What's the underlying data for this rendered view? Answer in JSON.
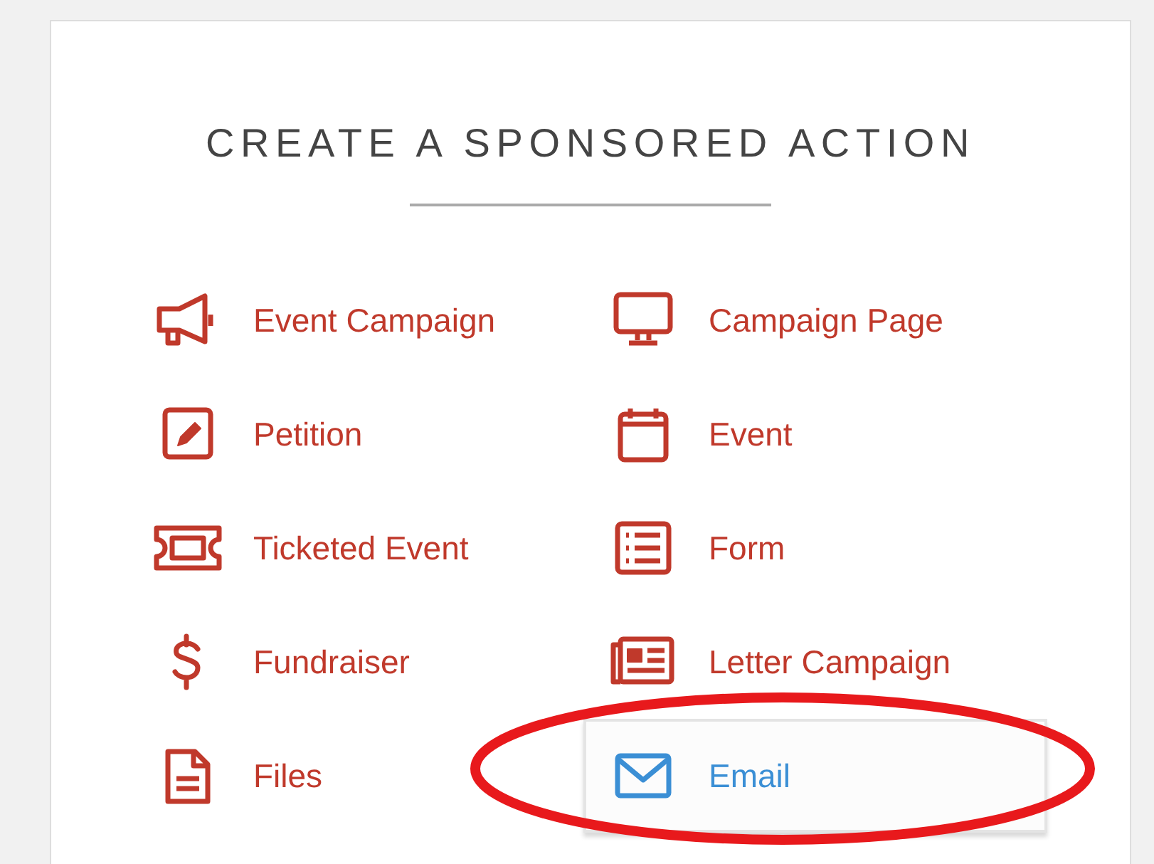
{
  "title": "CREATE A SPONSORED ACTION",
  "actions": [
    {
      "label": "Event Campaign",
      "kind": "megaphone",
      "selected": false,
      "circled": false
    },
    {
      "label": "Campaign Page",
      "kind": "monitor",
      "selected": false,
      "circled": false
    },
    {
      "label": "Petition",
      "kind": "edit",
      "selected": false,
      "circled": false
    },
    {
      "label": "Event",
      "kind": "calendar",
      "selected": false,
      "circled": false
    },
    {
      "label": "Ticketed Event",
      "kind": "ticket",
      "selected": false,
      "circled": false
    },
    {
      "label": "Form",
      "kind": "list",
      "selected": false,
      "circled": false
    },
    {
      "label": "Fundraiser",
      "kind": "dollar",
      "selected": false,
      "circled": false
    },
    {
      "label": "Letter Campaign",
      "kind": "newspaper",
      "selected": false,
      "circled": false
    },
    {
      "label": "Files",
      "kind": "file",
      "selected": false,
      "circled": false
    },
    {
      "label": "Email",
      "kind": "envelope",
      "selected": true,
      "circled": true
    }
  ]
}
